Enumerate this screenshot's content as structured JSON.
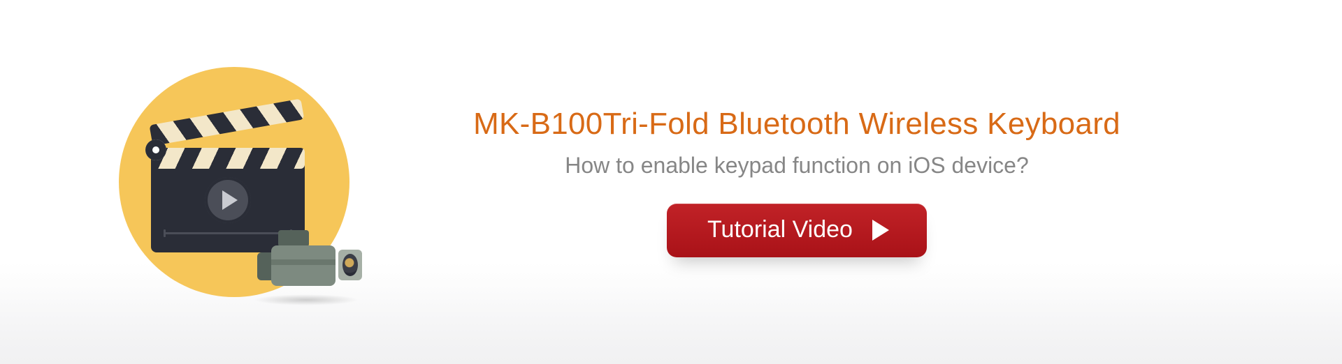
{
  "colors": {
    "title": "#d86a16",
    "subtitle": "#868686",
    "button_bg_top": "#c12227",
    "button_bg_bottom": "#a91218",
    "circle": "#f6c659"
  },
  "illustration": {
    "name": "clapperboard-camcorder-illustration",
    "icons": [
      "clapperboard-icon",
      "play-icon",
      "camcorder-icon"
    ]
  },
  "title": "MK-B100Tri-Fold Bluetooth Wireless Keyboard",
  "subtitle": "How to enable keypad function on iOS device?",
  "button": {
    "label": "Tutorial Video",
    "icon": "play-icon"
  }
}
